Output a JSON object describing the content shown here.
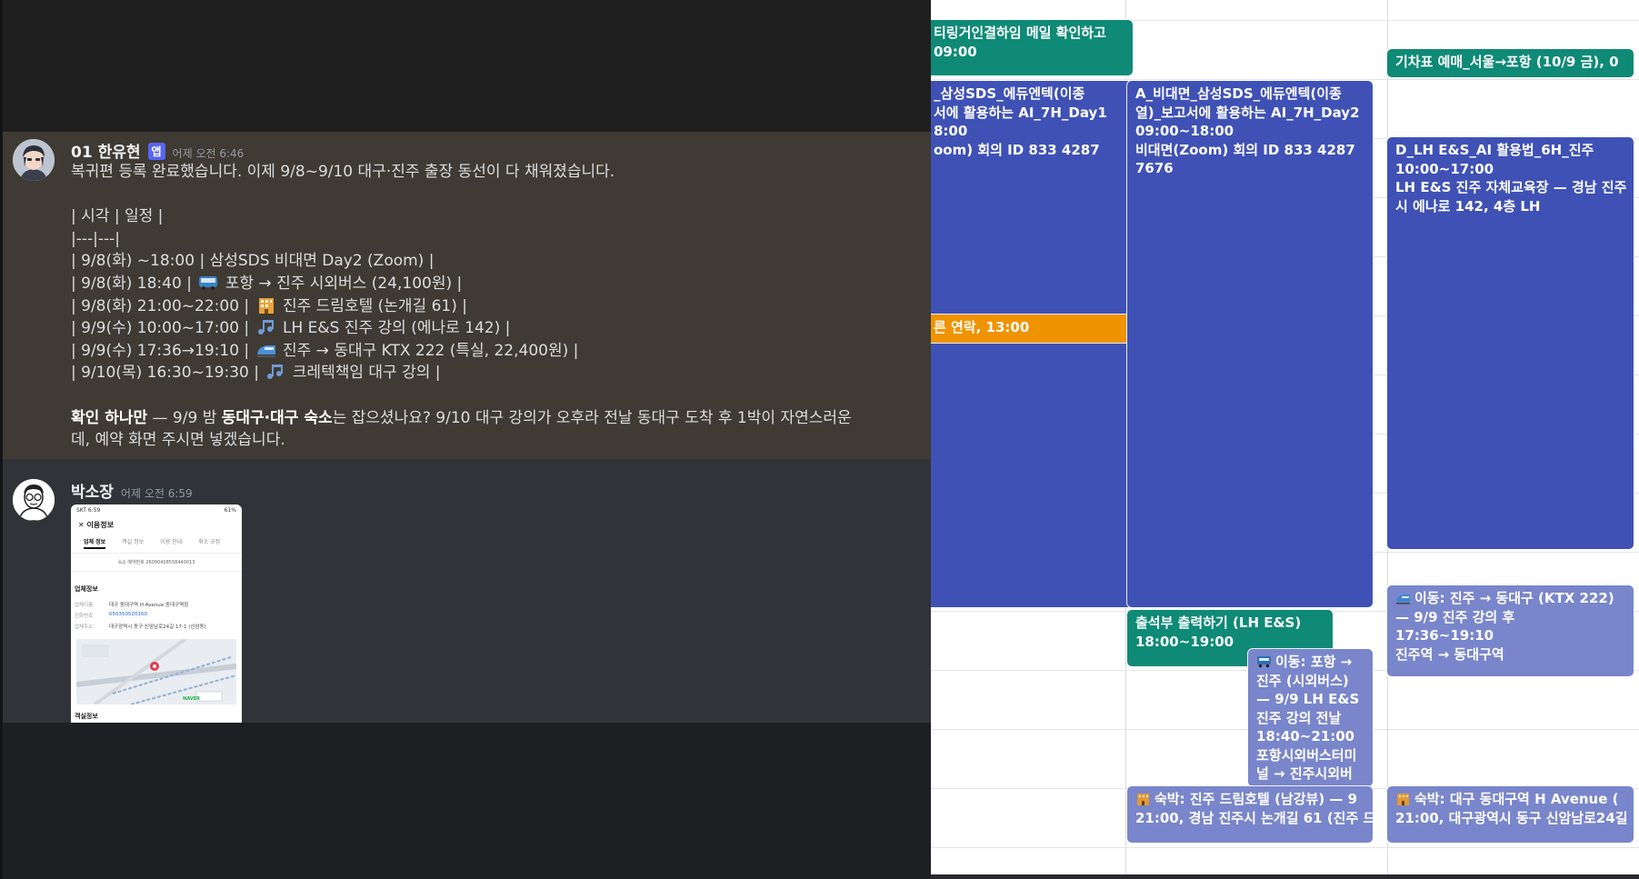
{
  "chat": {
    "messages": [
      {
        "author": "01 한유현",
        "badge": "앱",
        "time": "어제 오전 6:46",
        "lines": {
          "l0": "복귀편 등록 완료했습니다. 이제 9/8~9/10 대구·진주 출장 동선이 다 채워졌습니다.",
          "l1": "| 시각 | 일정 |",
          "l2": "|---|---|",
          "l3": "| 9/8(화) ~18:00 | 삼성SDS 비대면 Day2 (Zoom) |",
          "l4a": "| 9/8(화) 18:40 |",
          "l4b": "포항 → 진주 시외버스 (24,100원) |",
          "l5a": "| 9/8(화) 21:00~22:00 |",
          "l5b": "진주 드림호텔 (논개길 61) |",
          "l6a": "| 9/9(수) 10:00~17:00 |",
          "l6b": "LH E&S 진주 강의 (에나로 142) |",
          "l7a": "| 9/9(수) 17:36→19:10 |",
          "l7b": "진주 → 동대구 KTX 222 (특실, 22,400원) |",
          "l8a": "| 9/10(목) 16:30~19:30 |",
          "l8b": "크레텍책임 대구 강의 |",
          "l9a": "확인 하나만",
          "l9b": " — 9/9 밤 ",
          "l9c": "동대구·대구 숙소",
          "l9d": "는 잡으셨나요? 9/10 대구 강의가 오후라 전날 동대구 도착 후 1박이 자연스러운",
          "l10": "데, 예약 화면 주시면 넣겠습니다."
        }
      },
      {
        "author": "박소장",
        "time": "어제 오전 6:59",
        "attachment": {
          "status_left": "SKT 6:59",
          "status_right": "61%",
          "title": "이용정보",
          "tabs": [
            "업체 정보",
            "객실 정보",
            "이용 안내",
            "취소 규정"
          ],
          "confirm": "숙소 예약번호 26090408558440013",
          "section": "업체정보",
          "rows": [
            {
              "k": "업체이름",
              "v": "대구 동대구역 H Avenue 동대구역점"
            },
            {
              "k": "전화번호",
              "v": "050350520160"
            },
            {
              "k": "업체주소",
              "v": "대구광역시 동구 신암남로24길 17-1 (신암동)"
            }
          ],
          "map_label": "NAVER",
          "section2": "객실정보"
        }
      }
    ]
  },
  "calendar": {
    "events": {
      "e1": "티링거인결하임 메일 확인하고",
      "e1b": "09:00",
      "e2a": "_삼성SDS_에듀엔텍(이종",
      "e2b": "서에 활용하는 AI_7H_Day1",
      "e2c": "8:00",
      "e2d": "oom) 회의 ID 833 4287",
      "e3": "른 연락, 13:00",
      "e4a": "A_비대면_삼성SDS_에듀엔텍(이종",
      "e4b": "열)_보고서에 활용하는 AI_7H_Day2",
      "e4c": "09:00~18:00",
      "e4d": "비대면(Zoom) 회의 ID 833 4287",
      "e4e": "7676",
      "e5a": "출석부 출력하기 (LH E&S)",
      "e5b": "18:00~19:00",
      "e6a": "이동: 포항 →",
      "e6b": "진주 (시외버스)",
      "e6c": "— 9/9 LH E&S",
      "e6d": "진주 강의 전날",
      "e6e": "18:40~21:00",
      "e6f": "포항시외버스터미",
      "e6g": "널 → 진주시외버",
      "e7a": "숙박: 진주 드림호텔 (남강뷰) — 9",
      "e7b": "21:00, 경남 진주시 논개길 61 (진주 드",
      "e8": "기차표 예매_서울→포항 (10/9 금), 0",
      "e9a": "D_LH E&S_AI 활용법_6H_진주",
      "e9b": "10:00~17:00",
      "e9c": "LH E&S 진주 자체교육장 — 경남 진주",
      "e9d": "시 에나로 142, 4층 LH",
      "e10a": "이동: 진주 → 동대구 (KTX 222)",
      "e10b": "— 9/9 진주 강의 후",
      "e10c": "17:36~19:10",
      "e10d": "진주역 → 동대구역",
      "e11a": "숙박: 대구 동대구역 H Avenue (",
      "e11b": "21:00, 대구광역시 동구 신암남로24길"
    },
    "colors": {
      "green": "#0e8a76",
      "blue": "#3f51b5",
      "lavender": "#7986cb",
      "orange": "#f09300"
    }
  }
}
